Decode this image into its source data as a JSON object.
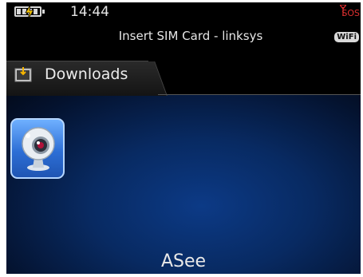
{
  "status": {
    "time": "14:44",
    "network": "Insert SIM Card - linksys",
    "sos": "SOS",
    "wifi": "WiFi"
  },
  "tab": {
    "label": "Downloads"
  },
  "apps": [
    {
      "name": "ASee",
      "icon": "webcam-icon",
      "selected": true
    }
  ],
  "focused_app_name": "ASee",
  "colors": {
    "selection_border": "#b5d6ff",
    "sos": "#e03030"
  }
}
